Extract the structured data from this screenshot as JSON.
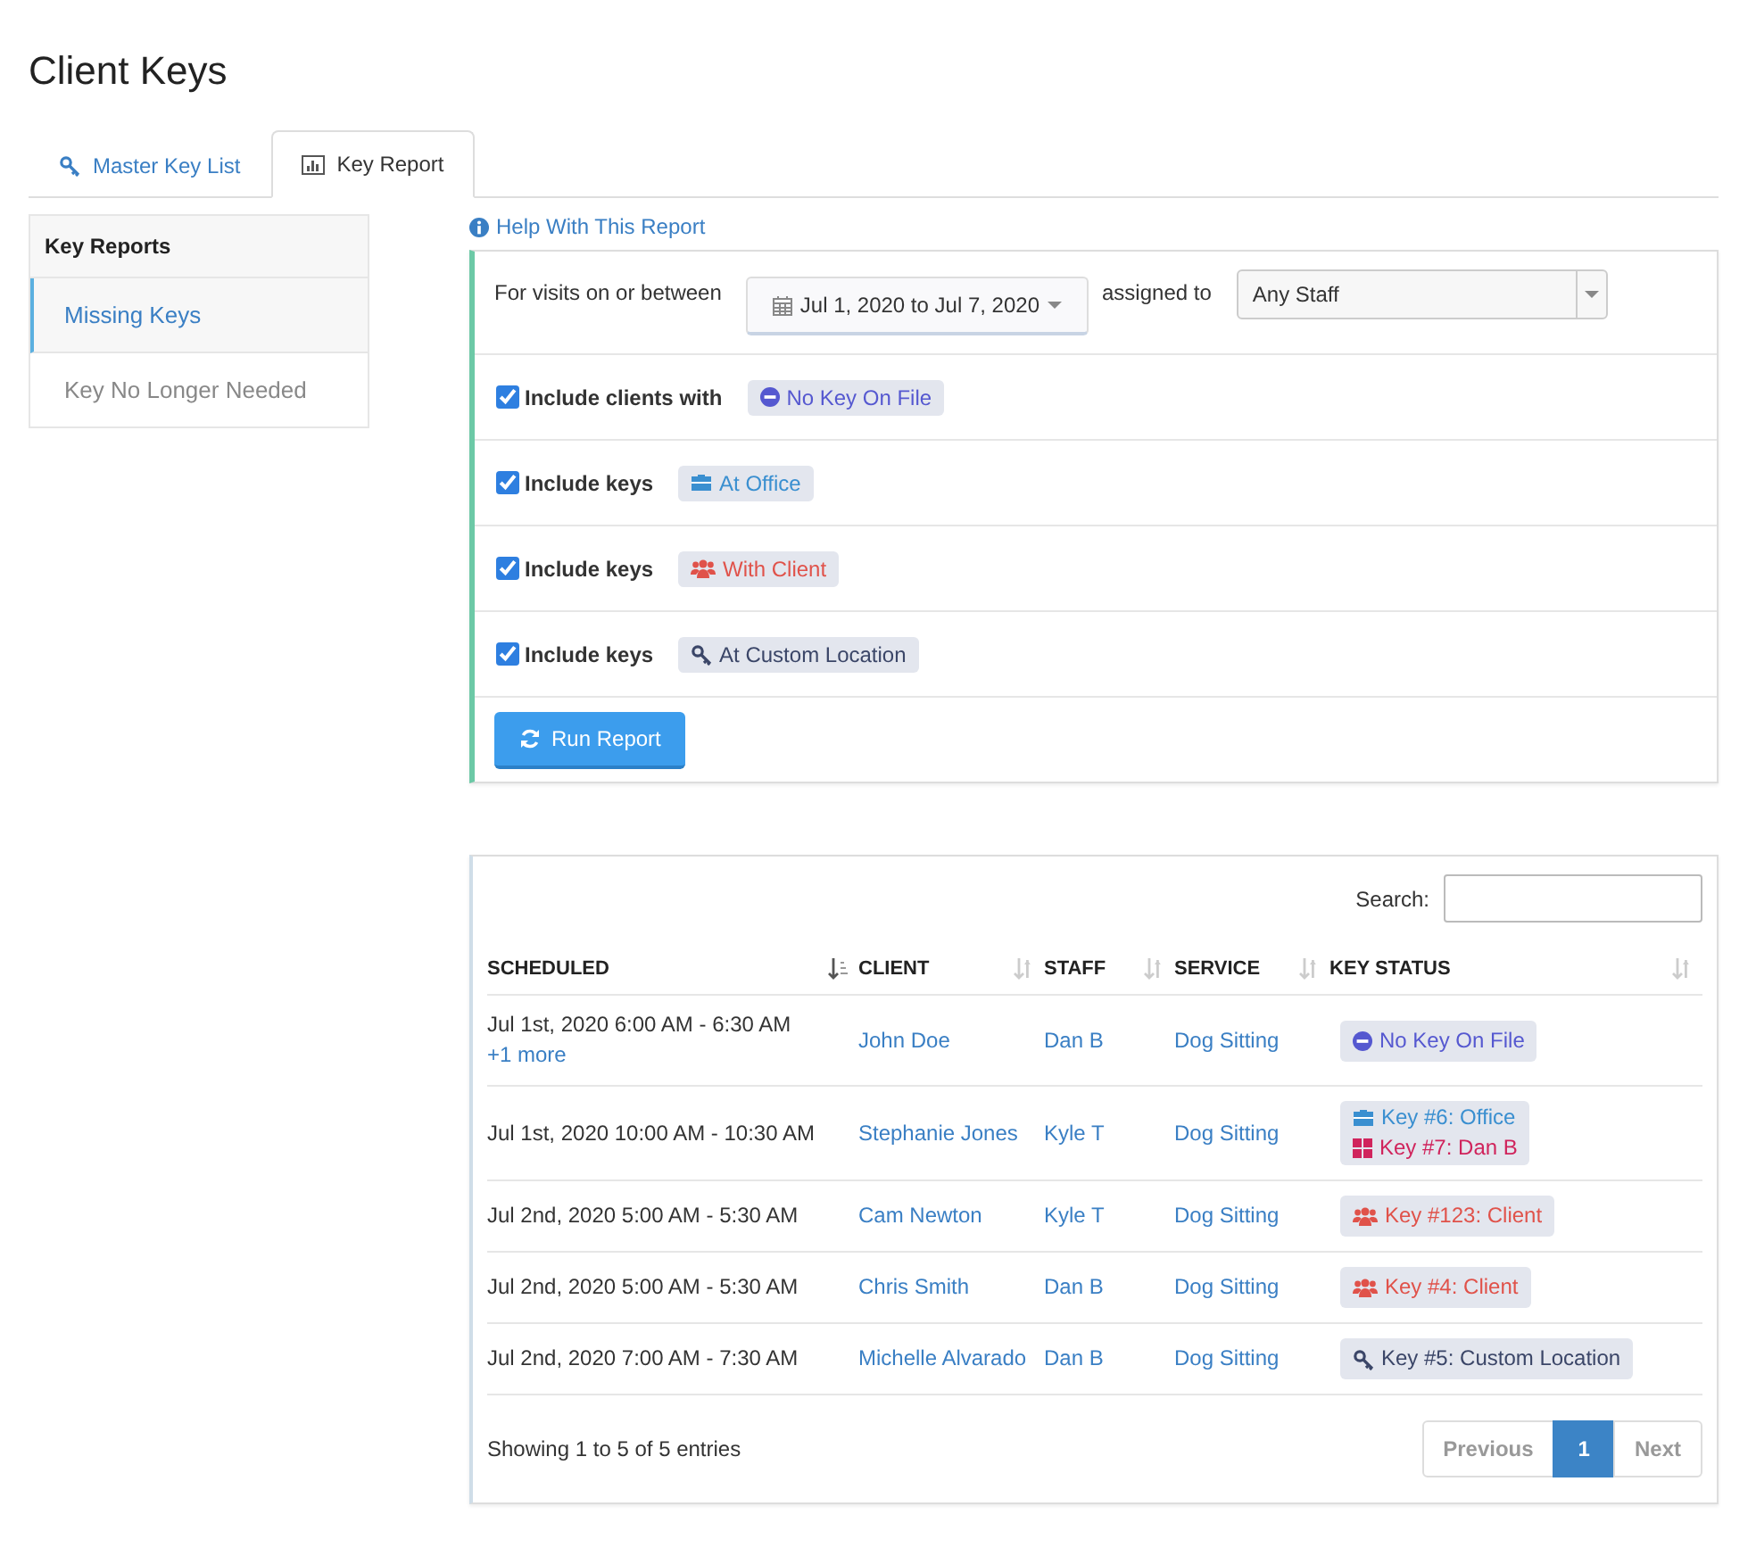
{
  "page_title": "Client Keys",
  "tabs": [
    {
      "label": "Master Key List",
      "kind": "key",
      "selected": false
    },
    {
      "label": "Key Report",
      "kind": "chart",
      "selected": true
    }
  ],
  "sidebar": {
    "title": "Key Reports",
    "items": [
      {
        "label": "Missing Keys",
        "selected": true
      },
      {
        "label": "Key No Longer Needed",
        "selected": false
      }
    ]
  },
  "help_link": "Help With This Report",
  "filters": {
    "date_label": "For visits on or between",
    "date_range": "Jul 1, 2020 to Jul 7, 2020",
    "assigned_label": "assigned to",
    "staff": "Any Staff",
    "includes": [
      {
        "label": "Include clients with",
        "checked": true,
        "tag": {
          "kind": "none",
          "text": "No Key On File"
        }
      },
      {
        "label": "Include keys",
        "checked": true,
        "tag": {
          "kind": "office",
          "text": "At Office"
        }
      },
      {
        "label": "Include keys",
        "checked": true,
        "tag": {
          "kind": "client",
          "text": "With Client"
        }
      },
      {
        "label": "Include keys",
        "checked": true,
        "tag": {
          "kind": "custom",
          "text": "At Custom Location"
        }
      }
    ],
    "run_button": "Run Report"
  },
  "table": {
    "search_label": "Search:",
    "columns": [
      {
        "label": "SCHEDULED",
        "sorted": true
      },
      {
        "label": "CLIENT",
        "sorted": false
      },
      {
        "label": "STAFF",
        "sorted": false
      },
      {
        "label": "SERVICE",
        "sorted": false
      },
      {
        "label": "KEY STATUS",
        "sorted": false
      }
    ],
    "rows": [
      {
        "scheduled": "Jul 1st, 2020 6:00 AM - 6:30 AM",
        "more": "+1 more",
        "client": "John Doe",
        "staff": "Dan B",
        "service": "Dog Sitting",
        "keys": [
          {
            "kind": "none",
            "text": "No Key On File"
          }
        ]
      },
      {
        "scheduled": "Jul 1st, 2020 10:00 AM - 10:30 AM",
        "client": "Stephanie Jones",
        "staff": "Kyle T",
        "service": "Dog Sitting",
        "keys": [
          {
            "kind": "office",
            "text": "Key #6: Office"
          },
          {
            "kind": "staff",
            "text": "Key #7: Dan B"
          }
        ]
      },
      {
        "scheduled": "Jul 2nd, 2020 5:00 AM - 5:30 AM",
        "client": "Cam Newton",
        "staff": "Kyle T",
        "service": "Dog Sitting",
        "keys": [
          {
            "kind": "client",
            "text": "Key #123: Client"
          }
        ]
      },
      {
        "scheduled": "Jul 2nd, 2020 5:00 AM - 5:30 AM",
        "client": "Chris Smith",
        "staff": "Dan B",
        "service": "Dog Sitting",
        "keys": [
          {
            "kind": "client",
            "text": "Key #4: Client"
          }
        ]
      },
      {
        "scheduled": "Jul 2nd, 2020 7:00 AM - 7:30 AM",
        "client": "Michelle Alvarado",
        "staff": "Dan B",
        "service": "Dog Sitting",
        "keys": [
          {
            "kind": "custom",
            "text": "Key #5: Custom Location"
          }
        ]
      }
    ],
    "info": "Showing 1 to 5 of 5 entries",
    "pagination": [
      {
        "label": "Previous",
        "kind": "step",
        "selected": false
      },
      {
        "label": "1",
        "kind": "page",
        "selected": true
      },
      {
        "label": "Next",
        "kind": "step",
        "selected": false
      }
    ]
  }
}
